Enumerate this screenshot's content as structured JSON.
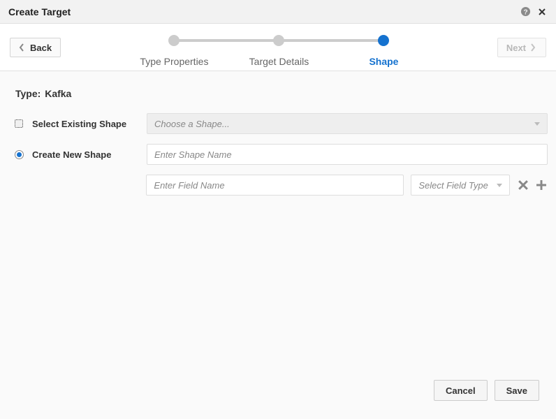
{
  "header": {
    "title": "Create Target"
  },
  "nav": {
    "back_label": "Back",
    "next_label": "Next"
  },
  "stepper": {
    "steps": [
      {
        "label": "Type Properties"
      },
      {
        "label": "Target Details"
      },
      {
        "label": "Shape"
      }
    ],
    "active_index": 2
  },
  "content": {
    "type_label": "Type:",
    "type_value": "Kafka",
    "select_existing_label": "Select Existing Shape",
    "create_new_label": "Create New Shape",
    "selected_option": "create_new",
    "choose_shape_placeholder": "Choose a Shape...",
    "shape_name_placeholder": "Enter Shape Name",
    "field_name_placeholder": "Enter Field Name",
    "field_type_placeholder": "Select Field Type"
  },
  "footer": {
    "cancel_label": "Cancel",
    "save_label": "Save"
  }
}
